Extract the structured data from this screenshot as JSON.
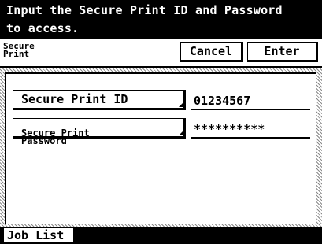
{
  "header": {
    "line1": "Input the Secure Print ID and Password",
    "line2": "to access."
  },
  "titlebar": {
    "mode_label": "Secure\nPrint",
    "cancel_label": "Cancel",
    "enter_label": "Enter"
  },
  "form": {
    "secure_id_label": "Secure Print ID",
    "secure_id_value": "01234567",
    "secure_password_label": "Secure Print\nPassword",
    "secure_password_value": "**********"
  },
  "footer": {
    "job_list_label": "Job List"
  }
}
